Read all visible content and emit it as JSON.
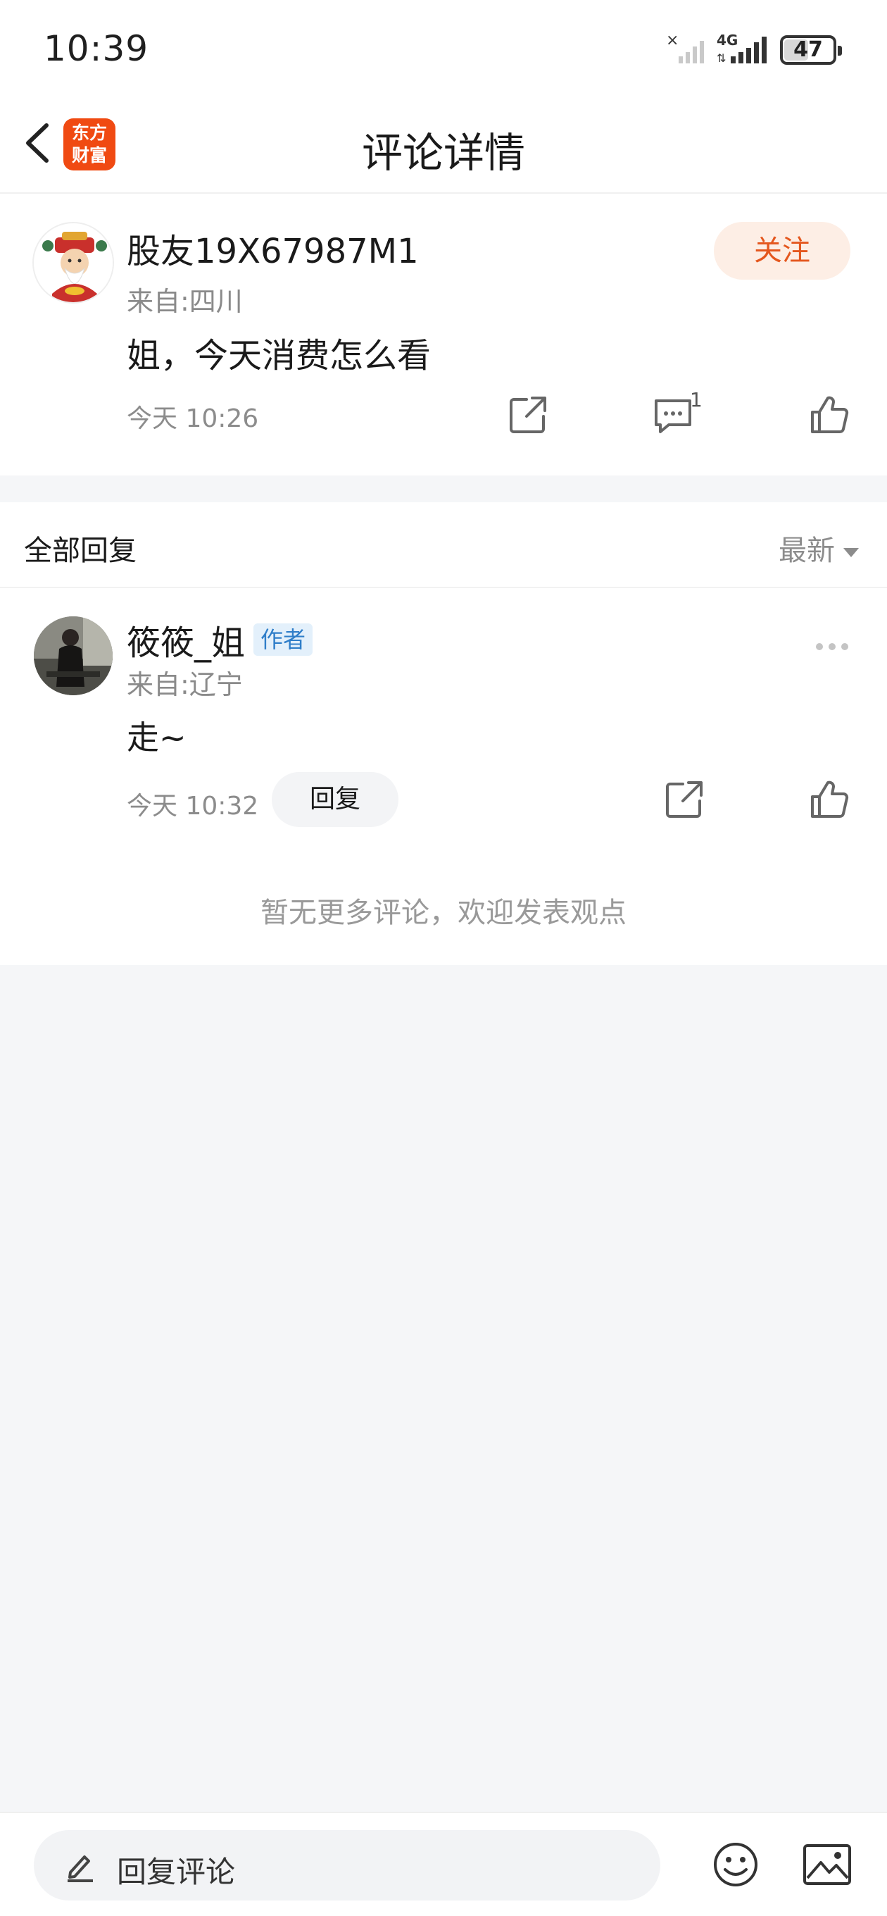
{
  "status_bar": {
    "time": "10:39",
    "network_label": "4G",
    "battery_level": "47",
    "battery_fraction": 0.47
  },
  "header": {
    "title": "评论详情",
    "logo_text_line1": "东方",
    "logo_text_line2": "财富",
    "accent_color": "#f04a12"
  },
  "main_comment": {
    "username": "股友19X67987M1",
    "location": "来自:四川",
    "content": "姐，今天消费怎么看",
    "time": "今天 10:26",
    "follow_label": "关注",
    "reply_count": "1"
  },
  "replies_section": {
    "title": "全部回复",
    "sort_label": "最新",
    "items": [
      {
        "username": "筱筱_姐",
        "tag": "作者",
        "location": "来自:辽宁",
        "content": "走~",
        "time": "今天 10:32",
        "reply_label": "回复"
      }
    ],
    "no_more_text": "暂无更多评论，欢迎发表观点"
  },
  "bottom_bar": {
    "input_placeholder": "回复评论"
  }
}
